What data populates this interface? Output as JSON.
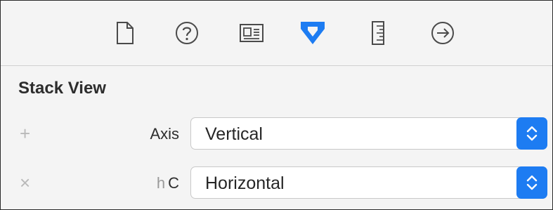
{
  "toolbar": {
    "icons": [
      "file-icon",
      "help-icon",
      "identity-icon",
      "attributes-icon",
      "size-icon",
      "connections-icon"
    ],
    "accent": "#1d7cf2",
    "icon_color": "#4a4a4a"
  },
  "section": {
    "title": "Stack View"
  },
  "rows": [
    {
      "sign": "+",
      "modifier": "",
      "label": "Axis",
      "value": "Vertical"
    },
    {
      "sign": "×",
      "modifier": "h",
      "label": "C",
      "value": "Horizontal"
    }
  ]
}
